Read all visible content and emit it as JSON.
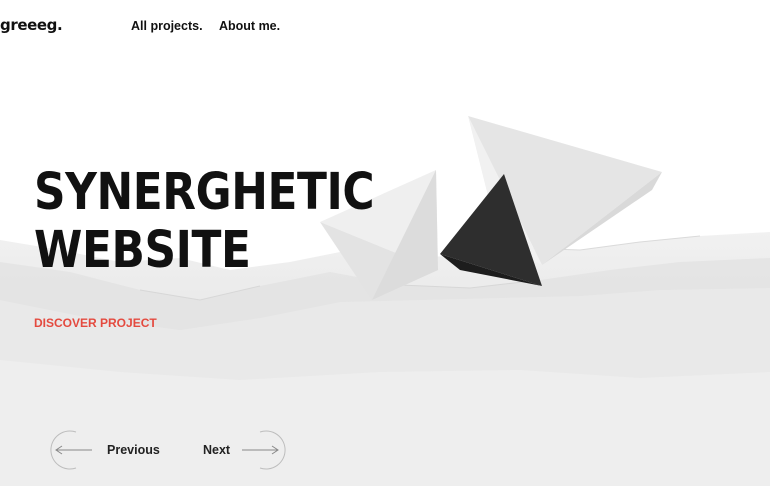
{
  "brand": {
    "logo": "greeeg."
  },
  "nav": [
    {
      "label": "All projects."
    },
    {
      "label": "About me."
    }
  ],
  "hero": {
    "title_line1": "SYNERGHETIC",
    "title_line2": "WEBSITE",
    "cta": "DISCOVER PROJECT"
  },
  "pager": {
    "previous": "Previous",
    "next": "Next"
  },
  "colors": {
    "accent": "#e44a3f",
    "text": "#111111",
    "background": "#ffffff"
  },
  "icons": {
    "previous": "arrow-left-circle-icon",
    "next": "arrow-right-circle-icon"
  }
}
